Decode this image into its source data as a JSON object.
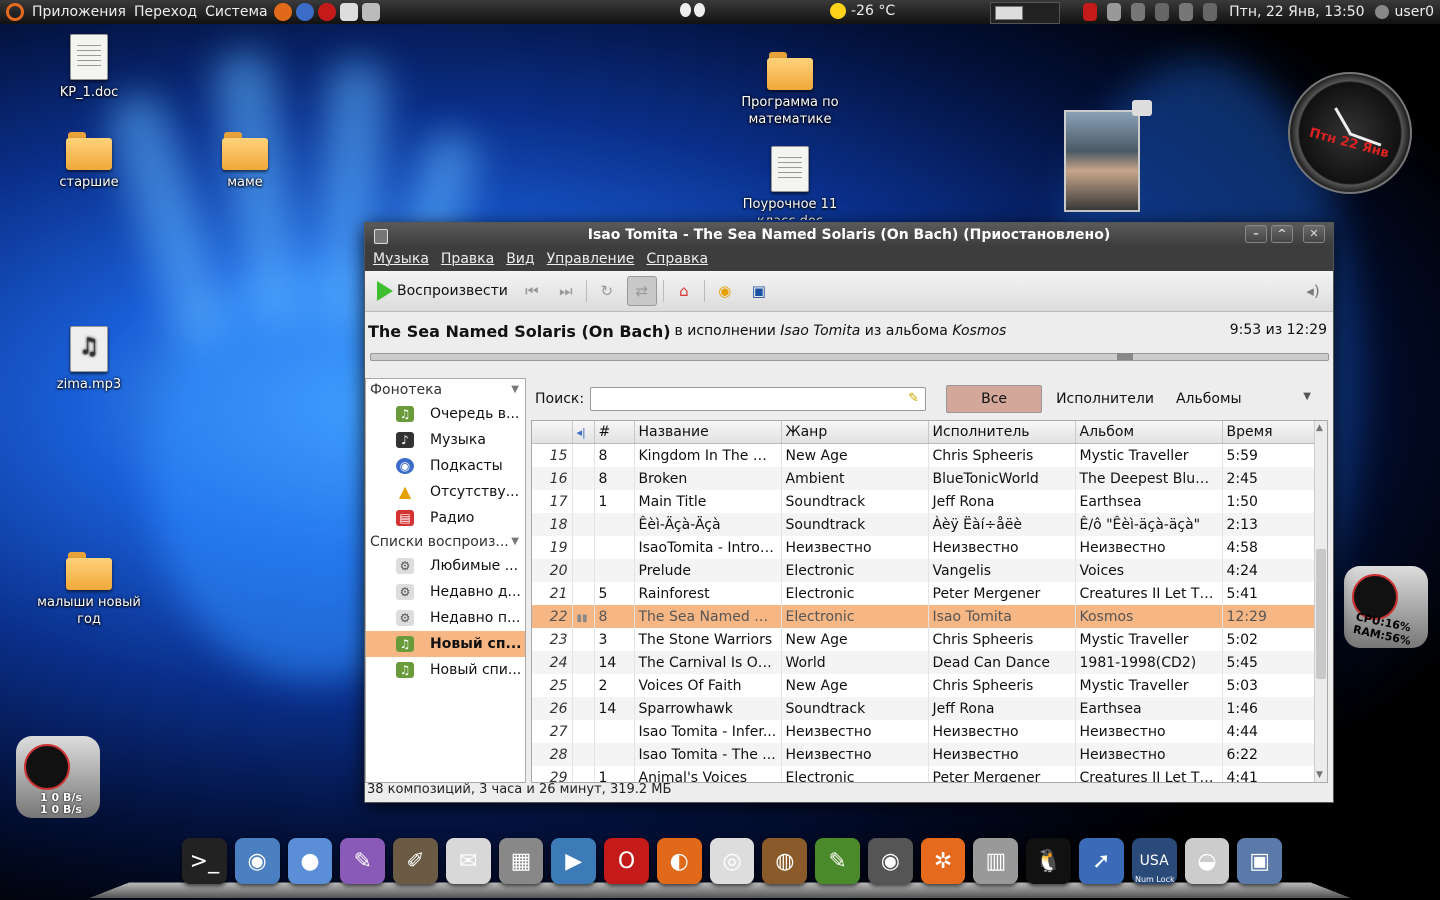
{
  "top_panel": {
    "menus": [
      "Приложения",
      "Переход",
      "Система"
    ],
    "weather": "-26 °C",
    "clock": "Птн, 22 Янв, 13:50",
    "user": "user0"
  },
  "desktop_icons": [
    {
      "label": "KP_1.doc",
      "type": "doc"
    },
    {
      "label": "старшие",
      "type": "folder"
    },
    {
      "label": "маме",
      "type": "folder"
    },
    {
      "label": "zima.mp3",
      "type": "mp3"
    },
    {
      "label": "малыши новый год",
      "type": "folder"
    },
    {
      "label": "Программа по математике",
      "type": "folder"
    },
    {
      "label": "Поурочное 11 класс.doc",
      "type": "doc"
    }
  ],
  "clock_widget": {
    "date": "Птн 22 Янв"
  },
  "cpu_widget": {
    "cpu": "CPU:16%",
    "ram": "RAM:56%"
  },
  "net_widget": {
    "down": "1 0 B/s",
    "up": "1 0 B/s"
  },
  "window": {
    "title": "Isao Tomita - The Sea Named Solaris (On Bach) (Приостановлено)",
    "menu": [
      "Музыка",
      "Правка",
      "Вид",
      "Управление",
      "Справка"
    ],
    "play_label": "Воспроизвести",
    "now_playing": {
      "title": "The Sea Named Solaris (On Bach)",
      "by": "в исполнении",
      "artist": "Isao Tomita",
      "from": "из альбома",
      "album": "Kosmos",
      "time": "9:53 из 12:29"
    },
    "sidebar": {
      "library_header": "Фонотека",
      "library_items": [
        {
          "label": "Очередь в...",
          "icon": "queue-icon",
          "color": "#6a9b3a"
        },
        {
          "label": "Музыка",
          "icon": "music-icon",
          "color": "#333333"
        },
        {
          "label": "Подкасты",
          "icon": "podcast-icon",
          "color": "#3b6cc9"
        },
        {
          "label": "Отсутству...",
          "icon": "warning-icon",
          "color": "#e6a100"
        },
        {
          "label": "Радио",
          "icon": "radio-icon",
          "color": "#d33333"
        }
      ],
      "playlists_header": "Списки воспроиз...",
      "playlist_items": [
        {
          "label": "Любимые ...",
          "icon": "smart-playlist-icon",
          "selected": false
        },
        {
          "label": "Недавно д...",
          "icon": "smart-playlist-icon",
          "selected": false
        },
        {
          "label": "Недавно п...",
          "icon": "smart-playlist-icon",
          "selected": false
        },
        {
          "label": "Новый сп...",
          "icon": "playlist-icon",
          "selected": true
        },
        {
          "label": "Новый спи...",
          "icon": "playlist-icon",
          "selected": false
        }
      ]
    },
    "search": {
      "label": "Поиск:",
      "value": ""
    },
    "filters": {
      "all": "Все",
      "artists": "Исполнители",
      "albums": "Альбомы"
    },
    "columns": [
      "#",
      "Название",
      "Жанр",
      "Исполнитель",
      "Альбом",
      "Время"
    ],
    "rows": [
      {
        "n": "15",
        "track": "8",
        "title": "Kingdom In The Cl...",
        "genre": "New Age",
        "artist": "Chris Spheeris",
        "album": "Mystic Traveller",
        "time": "5:59"
      },
      {
        "n": "16",
        "track": "8",
        "title": "Broken",
        "genre": "Ambient",
        "artist": "BlueTonicWorld",
        "album": "The Deepest Blue ...",
        "time": "2:45"
      },
      {
        "n": "17",
        "track": "1",
        "title": "Main Title",
        "genre": "Soundtrack",
        "artist": "Jeff Rona",
        "album": "Earthsea",
        "time": "1:50"
      },
      {
        "n": "18",
        "track": "",
        "title": "Êèì-Äçà-Äçà",
        "genre": "Soundtrack",
        "artist": "Àèÿ Ëàí÷åëè",
        "album": "Ê/ô \"Êèì-äçà-äçà\"",
        "time": "2:13"
      },
      {
        "n": "19",
        "track": "",
        "title": "IsaoTomita -  Introd...",
        "genre": "Неизвестно",
        "artist": "Неизвестно",
        "album": "Неизвестно",
        "time": "4:58"
      },
      {
        "n": "20",
        "track": "",
        "title": "Prelude",
        "genre": "Electronic",
        "artist": "Vangelis",
        "album": "Voices",
        "time": "4:24"
      },
      {
        "n": "21",
        "track": "5",
        "title": "Rainforest",
        "genre": "Electronic",
        "artist": "Peter Mergener",
        "album": "Creatures II Let Th...",
        "time": "5:41"
      },
      {
        "n": "22",
        "track": "8",
        "title": "The Sea Named So...",
        "genre": "Electronic",
        "artist": "Isao Tomita",
        "album": "Kosmos",
        "time": "12:29",
        "playing": true
      },
      {
        "n": "23",
        "track": "3",
        "title": "The Stone Warriors",
        "genre": "New Age",
        "artist": "Chris Spheeris",
        "album": "Mystic Traveller",
        "time": "5:02"
      },
      {
        "n": "24",
        "track": "14",
        "title": "The Carnival Is Over",
        "genre": "World",
        "artist": "Dead Can Dance",
        "album": "1981-1998(CD2)",
        "time": "5:45"
      },
      {
        "n": "25",
        "track": "2",
        "title": "Voices Of Faith",
        "genre": "New Age",
        "artist": "Chris Spheeris",
        "album": "Mystic Traveller",
        "time": "5:03"
      },
      {
        "n": "26",
        "track": "14",
        "title": "Sparrowhawk",
        "genre": "Soundtrack",
        "artist": "Jeff Rona",
        "album": "Earthsea",
        "time": "1:46"
      },
      {
        "n": "27",
        "track": "",
        "title": "Isao Tomita -  Infer...",
        "genre": "Неизвестно",
        "artist": "Неизвестно",
        "album": "Неизвестно",
        "time": "4:44"
      },
      {
        "n": "28",
        "track": "",
        "title": "Isao Tomita -  The ...",
        "genre": "Неизвестно",
        "artist": "Неизвестно",
        "album": "Неизвестно",
        "time": "6:22"
      },
      {
        "n": "29",
        "track": "1",
        "title": "Animal's Voices",
        "genre": "Electronic",
        "artist": "Peter Mergener",
        "album": "Creatures II Let Th...",
        "time": "4:41"
      }
    ],
    "status": "38 композиций, 3 часа и 26 минут, 319.2 МБ"
  },
  "dock": [
    {
      "icon": "terminal-icon",
      "color": "#222222",
      "glyph": ">_"
    },
    {
      "icon": "network-icon",
      "color": "#4a7fc2",
      "glyph": "◉"
    },
    {
      "icon": "footprints-icon",
      "color": "#5a8fd8",
      "glyph": "●"
    },
    {
      "icon": "pidgin-icon",
      "color": "#8a5ab8",
      "glyph": "✎"
    },
    {
      "icon": "gimp-icon",
      "color": "#6b5a44",
      "glyph": "✐"
    },
    {
      "icon": "mail-icon",
      "color": "#d8d8d8",
      "glyph": "✉"
    },
    {
      "icon": "calculator-icon",
      "color": "#888888",
      "glyph": "▦"
    },
    {
      "icon": "media-player-icon",
      "color": "#3c7ab8",
      "glyph": "▶"
    },
    {
      "icon": "opera-icon",
      "color": "#c41a1a",
      "glyph": "O"
    },
    {
      "icon": "firefox-icon",
      "color": "#e06a1a",
      "glyph": "◐"
    },
    {
      "icon": "rhythmbox-icon",
      "color": "#dddddd",
      "glyph": "◎"
    },
    {
      "icon": "shell-icon",
      "color": "#8a5a2a",
      "glyph": "◍"
    },
    {
      "icon": "text-editor-icon",
      "color": "#4a8a2a",
      "glyph": "✎"
    },
    {
      "icon": "speaker-icon",
      "color": "#555555",
      "glyph": "◉"
    },
    {
      "icon": "ubuntu-icon",
      "color": "#e66a1e",
      "glyph": "✲"
    },
    {
      "icon": "trash-icon",
      "color": "#999999",
      "glyph": "▥"
    },
    {
      "icon": "tux-icon",
      "color": "#111111",
      "glyph": "🐧"
    },
    {
      "icon": "pointer-icon",
      "color": "#3a6ab8",
      "glyph": "➚"
    },
    {
      "icon": "numlock-icon",
      "color": "#2a4a7a",
      "glyph": "USA"
    },
    {
      "icon": "drive-icon",
      "color": "#cccccc",
      "glyph": "◒"
    },
    {
      "icon": "monitor-icon",
      "color": "#5a7aaa",
      "glyph": "▣"
    }
  ],
  "dock_numlock": "Num Lock"
}
